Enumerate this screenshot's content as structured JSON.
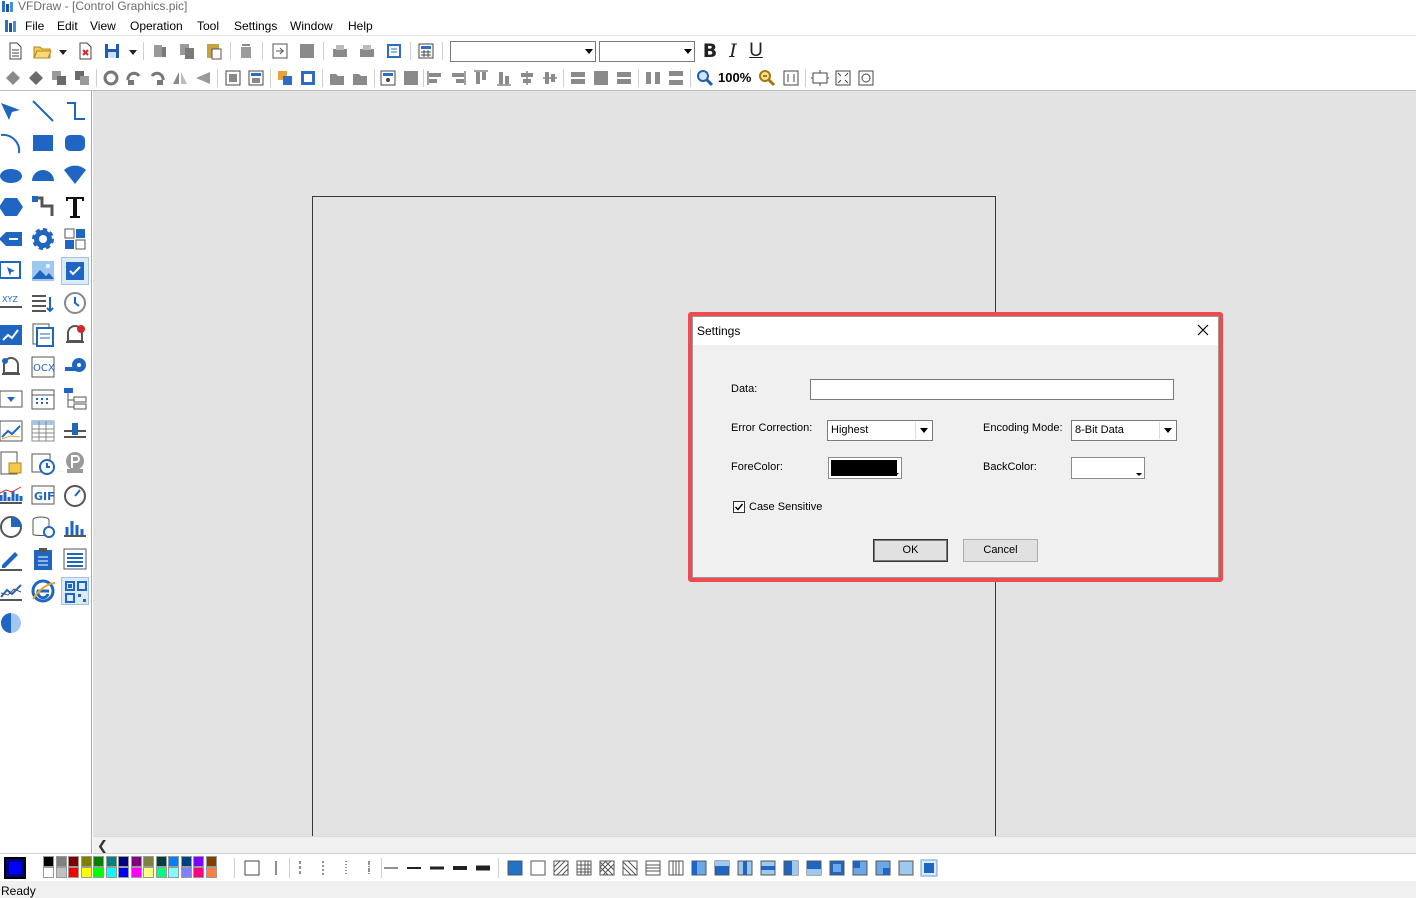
{
  "app": {
    "window_title": "VFDraw - [Control Graphics.pic]"
  },
  "menu": [
    "File",
    "Edit",
    "View",
    "Operation",
    "Tool",
    "Settings",
    "Window",
    "Help"
  ],
  "toolbar": {
    "font_combo_value": "",
    "size_combo_value": "",
    "bold_label": "B",
    "italic_label": "I",
    "underline_label": "U",
    "zoom_label": "100%"
  },
  "colors": {
    "accent_highlight": "#ee4b50",
    "workspace_bg": "#e3e3e3",
    "current_color": "#0000ff"
  },
  "palette_colors": [
    "#000000",
    "#808080",
    "#800000",
    "#808000",
    "#008000",
    "#008080",
    "#000080",
    "#800080",
    "#808040",
    "#004040",
    "#0080ff",
    "#004080",
    "#8000ff",
    "#804000",
    "#ffffff",
    "#c0c0c0",
    "#ff0000",
    "#ffff00",
    "#00ff00",
    "#00ffff",
    "#0000ff",
    "#ff00ff",
    "#ffff80",
    "#00ff80",
    "#80ffff",
    "#8080ff",
    "#ff0080",
    "#ff8040"
  ],
  "dialog": {
    "title": "Settings",
    "data_label": "Data:",
    "data_value": "",
    "error_correction_label": "Error Correction:",
    "error_correction_value": "Highest",
    "encoding_mode_label": "Encoding Mode:",
    "encoding_mode_value": "8-Bit Data",
    "forecolor_label": "ForeColor:",
    "forecolor_value": "#000000",
    "backcolor_label": "BackColor:",
    "backcolor_value": "#ffffff",
    "case_sensitive_label": "Case Sensitive",
    "case_sensitive_checked": true,
    "ok_label": "OK",
    "cancel_label": "Cancel"
  },
  "status": {
    "text": "Ready"
  }
}
